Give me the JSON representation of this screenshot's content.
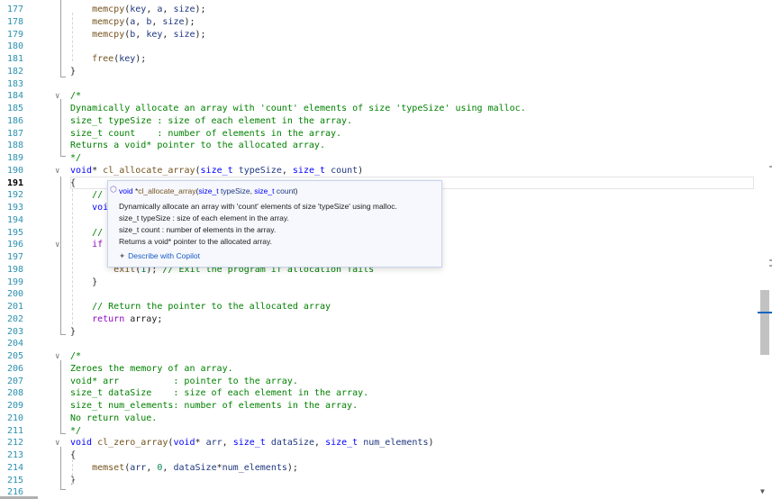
{
  "editor": {
    "current_line": "191",
    "lines": [
      {
        "n": "177",
        "fold": "",
        "html": "    memcpy(key, a, size);",
        "parts": [
          [
            "    ",
            ""
          ],
          [
            "memcpy",
            "fn"
          ],
          [
            "(",
            "",
            ""
          ],
          [
            "key",
            "param"
          ],
          [
            ", ",
            ""
          ],
          [
            "a",
            "param"
          ],
          [
            ", ",
            ""
          ],
          [
            "size",
            "param"
          ],
          [
            ");",
            ""
          ]
        ]
      },
      {
        "n": "178",
        "fold": "",
        "parts": [
          [
            "    ",
            ""
          ],
          [
            "memcpy",
            "fn"
          ],
          [
            "(",
            ""
          ],
          [
            "a",
            "param"
          ],
          [
            ", ",
            ""
          ],
          [
            "b",
            "param"
          ],
          [
            ", ",
            ""
          ],
          [
            "size",
            "param"
          ],
          [
            ");",
            ""
          ]
        ]
      },
      {
        "n": "179",
        "fold": "",
        "parts": [
          [
            "    ",
            ""
          ],
          [
            "memcpy",
            "fn"
          ],
          [
            "(",
            ""
          ],
          [
            "b",
            "param"
          ],
          [
            ", ",
            ""
          ],
          [
            "key",
            "param"
          ],
          [
            ", ",
            ""
          ],
          [
            "size",
            "param"
          ],
          [
            ");",
            ""
          ]
        ]
      },
      {
        "n": "180",
        "fold": "",
        "parts": []
      },
      {
        "n": "181",
        "fold": "",
        "parts": [
          [
            "    ",
            ""
          ],
          [
            "free",
            "fn"
          ],
          [
            "(",
            ""
          ],
          [
            "key",
            "param"
          ],
          [
            ");",
            ""
          ]
        ]
      },
      {
        "n": "182",
        "fold": "",
        "parts": [
          [
            "}",
            ""
          ]
        ]
      },
      {
        "n": "183",
        "fold": "",
        "parts": []
      },
      {
        "n": "184",
        "fold": "v",
        "parts": [
          [
            "/*",
            "comment"
          ]
        ]
      },
      {
        "n": "185",
        "fold": "",
        "parts": [
          [
            "Dynamically allocate an array with 'count' elements of size 'typeSize' using malloc.",
            "comment"
          ]
        ]
      },
      {
        "n": "186",
        "fold": "",
        "parts": [
          [
            "size_t typeSize : size of each element in the array.",
            "comment"
          ]
        ]
      },
      {
        "n": "187",
        "fold": "",
        "parts": [
          [
            "size_t count    : number of elements in the array.",
            "comment"
          ]
        ]
      },
      {
        "n": "188",
        "fold": "",
        "parts": [
          [
            "Returns a void* pointer to the allocated array.",
            "comment"
          ]
        ]
      },
      {
        "n": "189",
        "fold": "",
        "parts": [
          [
            "*/",
            "comment"
          ]
        ]
      },
      {
        "n": "190",
        "fold": "v",
        "parts": [
          [
            "void",
            "type"
          ],
          [
            "* ",
            ""
          ],
          [
            "cl_allocate_array",
            "fn"
          ],
          [
            "(",
            ""
          ],
          [
            "size_t",
            "type"
          ],
          [
            " ",
            ""
          ],
          [
            "typeSize",
            "param"
          ],
          [
            ", ",
            ""
          ],
          [
            "size_t",
            "type"
          ],
          [
            " ",
            ""
          ],
          [
            "count",
            "param"
          ],
          [
            ")",
            ""
          ]
        ]
      },
      {
        "n": "191",
        "fold": "",
        "parts": [
          [
            "{",
            ""
          ]
        ]
      },
      {
        "n": "192",
        "fold": "",
        "parts": [
          [
            "    //",
            "comment"
          ]
        ]
      },
      {
        "n": "193",
        "fold": "",
        "parts": [
          [
            "    voi",
            "type"
          ]
        ]
      },
      {
        "n": "194",
        "fold": "",
        "parts": []
      },
      {
        "n": "195",
        "fold": "",
        "parts": [
          [
            "    //",
            "comment"
          ]
        ]
      },
      {
        "n": "196",
        "fold": "v",
        "parts": [
          [
            "    if",
            "kw"
          ]
        ]
      },
      {
        "n": "197",
        "fold": "",
        "parts": []
      },
      {
        "n": "198",
        "fold": "",
        "parts": [
          [
            "        ",
            ""
          ],
          [
            "exit",
            "fn"
          ],
          [
            "(",
            ""
          ],
          [
            "1",
            "num"
          ],
          [
            "); ",
            ""
          ],
          [
            "// Exit the program if allocation fails",
            "comment"
          ]
        ]
      },
      {
        "n": "199",
        "fold": "",
        "parts": [
          [
            "    }",
            ""
          ]
        ]
      },
      {
        "n": "200",
        "fold": "",
        "parts": []
      },
      {
        "n": "201",
        "fold": "",
        "parts": [
          [
            "    // Return the pointer to the allocated array",
            "comment"
          ]
        ]
      },
      {
        "n": "202",
        "fold": "",
        "parts": [
          [
            "    ",
            ""
          ],
          [
            "return",
            "kw"
          ],
          [
            " array;",
            ""
          ]
        ]
      },
      {
        "n": "203",
        "fold": "",
        "parts": [
          [
            "}",
            ""
          ]
        ]
      },
      {
        "n": "204",
        "fold": "",
        "parts": []
      },
      {
        "n": "205",
        "fold": "v",
        "parts": [
          [
            "/*",
            "comment"
          ]
        ]
      },
      {
        "n": "206",
        "fold": "",
        "parts": [
          [
            "Zeroes the memory of an array.",
            "comment"
          ]
        ]
      },
      {
        "n": "207",
        "fold": "",
        "parts": [
          [
            "void* arr          : pointer to the array.",
            "comment"
          ]
        ]
      },
      {
        "n": "208",
        "fold": "",
        "parts": [
          [
            "size_t dataSize    : size of each element in the array.",
            "comment"
          ]
        ]
      },
      {
        "n": "209",
        "fold": "",
        "parts": [
          [
            "size_t num_elements: number of elements in the array.",
            "comment"
          ]
        ]
      },
      {
        "n": "210",
        "fold": "",
        "parts": [
          [
            "No return value.",
            "comment"
          ]
        ]
      },
      {
        "n": "211",
        "fold": "",
        "parts": [
          [
            "*/",
            "comment"
          ]
        ]
      },
      {
        "n": "212",
        "fold": "v",
        "parts": [
          [
            "void",
            "type"
          ],
          [
            " ",
            ""
          ],
          [
            "cl_zero_array",
            "fn"
          ],
          [
            "(",
            ""
          ],
          [
            "void",
            "type"
          ],
          [
            "* ",
            ""
          ],
          [
            "arr",
            "param"
          ],
          [
            ", ",
            ""
          ],
          [
            "size_t",
            "type"
          ],
          [
            " ",
            ""
          ],
          [
            "dataSize",
            "param"
          ],
          [
            ", ",
            ""
          ],
          [
            "size_t",
            "type"
          ],
          [
            " ",
            ""
          ],
          [
            "num_elements",
            "param"
          ],
          [
            ")",
            ""
          ]
        ]
      },
      {
        "n": "213",
        "fold": "",
        "parts": [
          [
            "{",
            ""
          ]
        ]
      },
      {
        "n": "214",
        "fold": "",
        "parts": [
          [
            "    ",
            ""
          ],
          [
            "memset",
            "fn"
          ],
          [
            "(",
            ""
          ],
          [
            "arr",
            "param"
          ],
          [
            ", ",
            ""
          ],
          [
            "0",
            "num"
          ],
          [
            ", ",
            ""
          ],
          [
            "dataSize",
            "param"
          ],
          [
            "*",
            ""
          ],
          [
            "num_elements",
            "param"
          ],
          [
            ");",
            ""
          ]
        ]
      },
      {
        "n": "215",
        "fold": "",
        "parts": [
          [
            "}",
            ""
          ]
        ]
      },
      {
        "n": "216",
        "fold": "",
        "parts": []
      }
    ]
  },
  "tooltip": {
    "icon": "cube-icon",
    "sig_ret": "void",
    "sig_star": " *",
    "sig_fn": "cl_allocate_array",
    "sig_open": "(",
    "sig_t1": "size_t",
    "sig_p1": " typeSize",
    "sig_comma": ", ",
    "sig_t2": "size_t",
    "sig_p2": " count",
    "sig_close": ")",
    "doc1": "Dynamically allocate an array with 'count' elements of size 'typeSize' using malloc.",
    "doc2": "size_t typeSize : size of each element in the array.",
    "doc3": "size_t count : number of elements in the array.",
    "doc4": "Returns a void* pointer to the allocated array.",
    "copilot_icon": "sparkle-icon",
    "copilot_label": "Describe with Copilot"
  },
  "colors": {
    "comment": "#008000",
    "type": "#0000ff",
    "keyword": "#8f08c4",
    "function": "#74531f",
    "parameter": "#1f377f",
    "line_number": "#2b91af",
    "link": "#1a5bc4"
  }
}
